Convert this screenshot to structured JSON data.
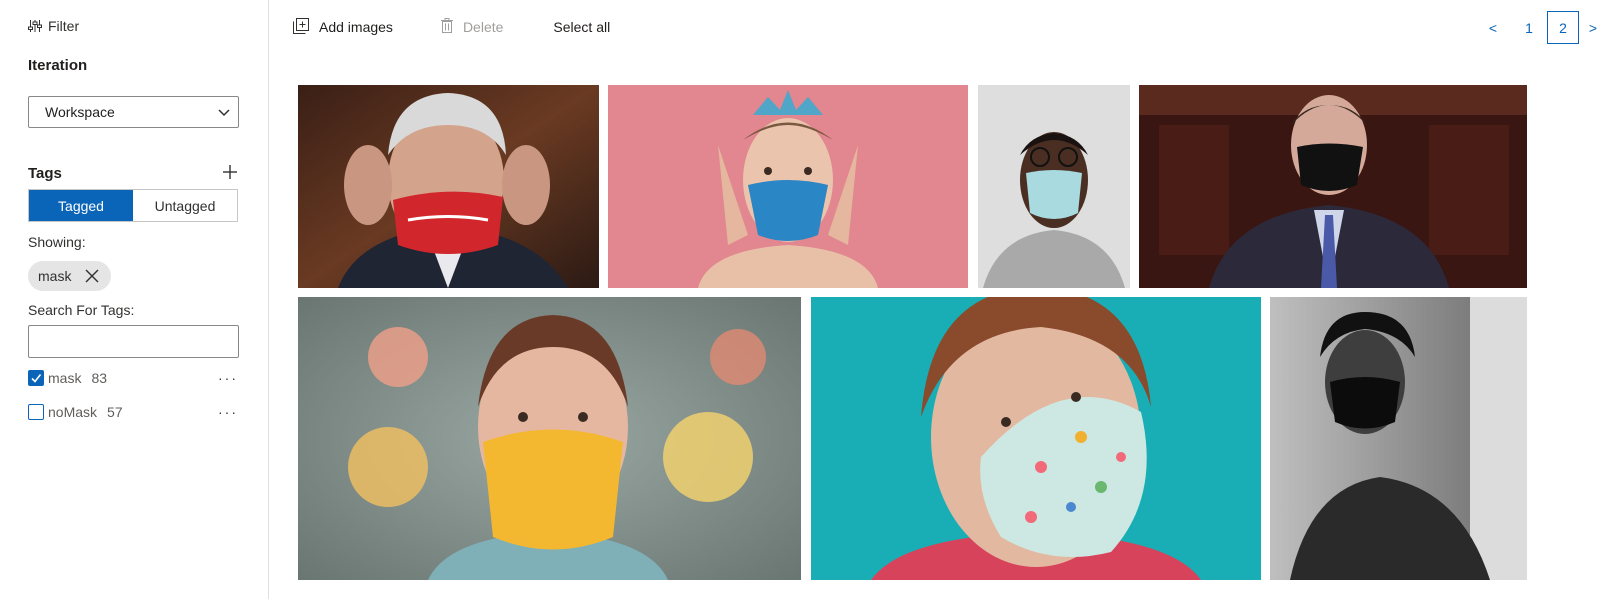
{
  "sidebar": {
    "filter_label": "Filter",
    "iteration_title": "Iteration",
    "iteration_select": "Workspace",
    "tags_title": "Tags",
    "segment": {
      "tagged": "Tagged",
      "untagged": "Untagged"
    },
    "showing_label": "Showing:",
    "active_filter_chip": "mask",
    "search_label": "Search For Tags:",
    "search_value": "",
    "tags": [
      {
        "name": "mask",
        "count": "83",
        "checked": true
      },
      {
        "name": "noMask",
        "count": "57",
        "checked": false
      }
    ],
    "more_glyph": "···"
  },
  "toolbar": {
    "add_images": "Add images",
    "delete": "Delete",
    "select_all": "Select all"
  },
  "pagination": {
    "prev": "<",
    "pages": [
      "1",
      "2"
    ],
    "current": "2",
    "next": ">"
  },
  "colors": {
    "accent": "#0a64b8",
    "border": "#8a8886",
    "chip_bg": "#e5e5e5"
  },
  "images": [
    {
      "id": "img-1",
      "subject": "older man adjusting red patterned mask"
    },
    {
      "id": "img-2",
      "subject": "woman with crown and blue sequin mask on pink background"
    },
    {
      "id": "img-3",
      "subject": "man with glasses wearing light blue surgical mask"
    },
    {
      "id": "img-4",
      "subject": "man in suit wearing black printed mask"
    },
    {
      "id": "img-5",
      "subject": "woman wearing yellow floral cloth mask"
    },
    {
      "id": "img-6",
      "subject": "woman wearing light blue floral cloth mask on teal background"
    },
    {
      "id": "img-7",
      "subject": "black and white photo of young man in dark mask"
    }
  ]
}
